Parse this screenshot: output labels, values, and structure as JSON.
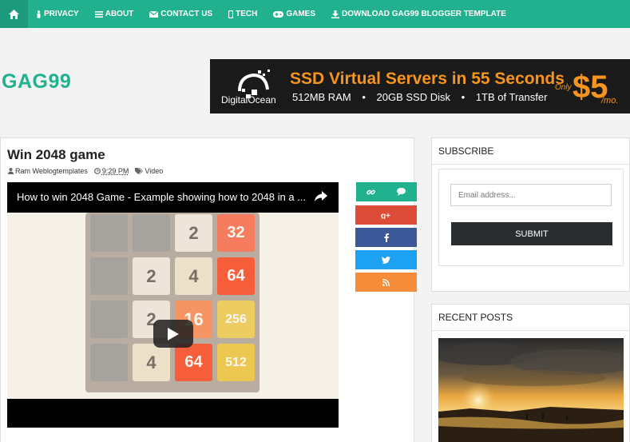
{
  "nav": {
    "home_icon": "home-icon",
    "items": [
      {
        "label": "PRIVACY",
        "icon": "person-icon"
      },
      {
        "label": "ABOUT",
        "icon": "menu-icon"
      },
      {
        "label": "CONTACT US",
        "icon": "envelope-icon"
      },
      {
        "label": "TECH",
        "icon": "mobile-icon"
      },
      {
        "label": "GAMES",
        "icon": "gamepad-icon"
      },
      {
        "label": "DOWNLOAD GAG99 BLOGGER TEMPLATE",
        "icon": "download-icon"
      }
    ]
  },
  "site": {
    "logo": "GAG99"
  },
  "ad": {
    "brand": "DigitalOcean",
    "headline": "SSD Virtual Servers in 55 Seconds",
    "features": [
      "512MB RAM",
      "20GB SSD Disk",
      "1TB of Transfer"
    ],
    "only": "Only",
    "price": "$5",
    "per": "/mo."
  },
  "post": {
    "title": "Win 2048 game",
    "author": "Ram Weblogtemplates",
    "time": "9:29 PM",
    "label": "Video",
    "video_title": "How to win 2048 Game - Example showing how to 2048 in a ...",
    "board": [
      [
        "",
        "",
        "2",
        "32"
      ],
      [
        "",
        "2",
        "4",
        "64"
      ],
      [
        "",
        "2",
        "16",
        "256"
      ],
      [
        "",
        "4",
        "64",
        "512"
      ]
    ]
  },
  "share": {
    "buttons": [
      "link-icon",
      "comment-icon",
      "google-plus-icon",
      "facebook-icon",
      "twitter-icon",
      "rss-icon"
    ],
    "colors": {
      "teal": "#21b18e",
      "google": "#dd4b39",
      "facebook": "#3b5998",
      "twitter": "#1da1f2",
      "rss": "#f48c3a"
    }
  },
  "sidebar": {
    "subscribe_title": "SUBSCRIBE",
    "email_placeholder": "Email address...",
    "submit_label": "SUBMIT",
    "recent_title": "RECENT POSTS"
  },
  "colors": {
    "accent": "#21b18e",
    "ad_orange": "#f7941d"
  }
}
